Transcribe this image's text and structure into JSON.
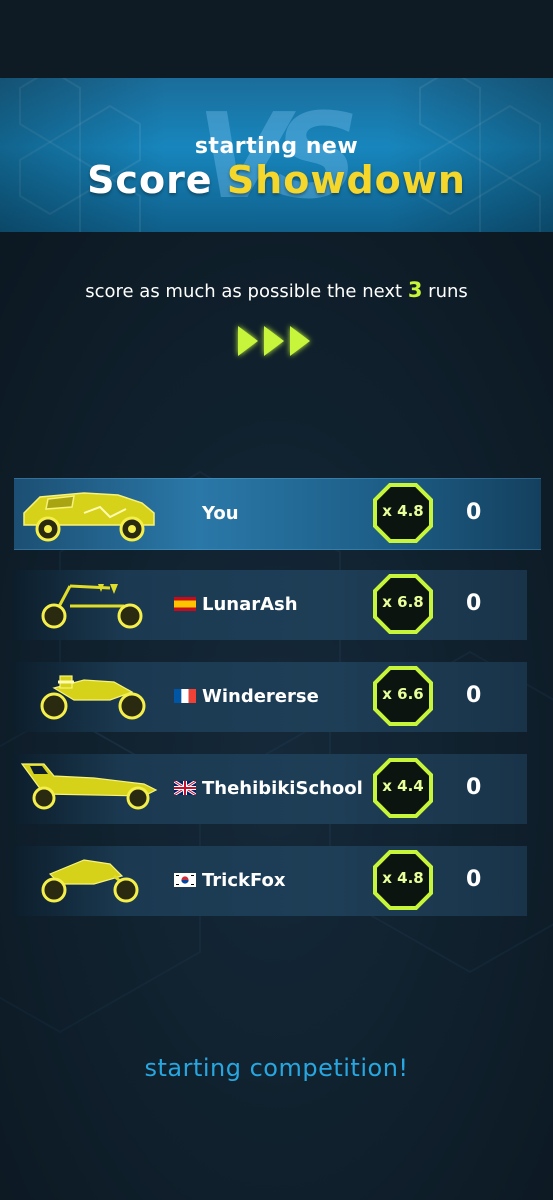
{
  "banner": {
    "subtitle": "starting new",
    "title_part1": "Score",
    "title_part2": "Showdown",
    "logo_text": "VS"
  },
  "instruction": {
    "before": "score as much as possible the next",
    "count": "3",
    "after": "runs"
  },
  "colors": {
    "accent_lime": "#c6f53a",
    "title_yellow": "#f5d72c",
    "banner_blue": "#1786bd",
    "footer_blue": "#27a6e0"
  },
  "players": [
    {
      "name": "You",
      "flag": "",
      "multiplier": "x 4.8",
      "score": "0",
      "vehicle": "armored-car-icon"
    },
    {
      "name": "LunarAsh",
      "flag": "spain-flag-icon",
      "multiplier": "x 6.8",
      "score": "0",
      "vehicle": "chopper-bike-icon"
    },
    {
      "name": "Windererse",
      "flag": "france-flag-icon",
      "multiplier": "x 6.6",
      "score": "0",
      "vehicle": "motorcycle-icon"
    },
    {
      "name": "ThehibikiSchool",
      "flag": "uk-flag-icon",
      "multiplier": "x 4.4",
      "score": "0",
      "vehicle": "dune-buggy-icon"
    },
    {
      "name": "TrickFox",
      "flag": "south-korea-flag-icon",
      "multiplier": "x 4.8",
      "score": "0",
      "vehicle": "sport-bike-icon"
    }
  ],
  "footer": {
    "status": "starting competition!"
  }
}
